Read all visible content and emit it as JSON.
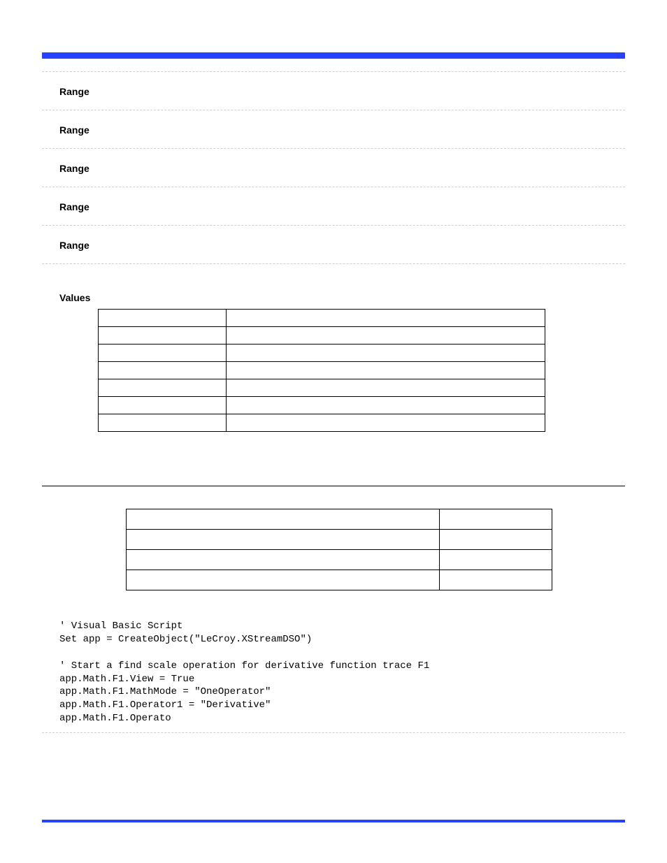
{
  "header": {
    "right_title": ""
  },
  "params": [
    {
      "title": "Range",
      "desc": ""
    },
    {
      "title": "Range",
      "desc": ""
    },
    {
      "title": "Range",
      "desc": ""
    },
    {
      "title": "Range",
      "desc": ""
    },
    {
      "title": "Range",
      "desc": ""
    }
  ],
  "values_label": "Values",
  "values_rows": [
    {
      "c0": "",
      "c1": ""
    },
    {
      "c0": "",
      "c1": ""
    },
    {
      "c0": "",
      "c1": ""
    },
    {
      "c0": "",
      "c1": ""
    },
    {
      "c0": "",
      "c1": ""
    },
    {
      "c0": "",
      "c1": ""
    },
    {
      "c0": "",
      "c1": ""
    }
  ],
  "section": {
    "title": "",
    "path": ""
  },
  "attr_rows": [
    {
      "a0": "",
      "a1": ""
    },
    {
      "a0": "",
      "a1": ""
    },
    {
      "a0": "",
      "a1": ""
    },
    {
      "a0": "",
      "a1": ""
    }
  ],
  "example_label": "",
  "code": "' Visual Basic Script\nSet app = CreateObject(\"LeCroy.XStreamDSO\")\n\n' Start a find scale operation for derivative function trace F1\napp.Math.F1.View = True\napp.Math.F1.MathMode = \"OneOperator\"\napp.Math.F1.Operator1 = \"Derivative\"\napp.Math.F1.Operato",
  "footer": {
    "left": "",
    "right": ""
  }
}
